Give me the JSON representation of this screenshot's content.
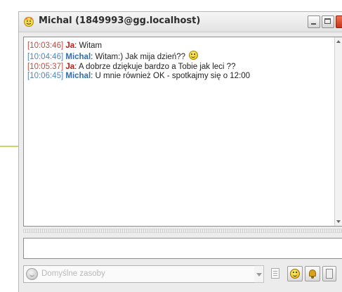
{
  "window": {
    "title": "Michal (1849993@gg.localhost)"
  },
  "chat": {
    "messages": [
      {
        "timestamp": "[10:03:46]",
        "nick": "Ja",
        "separator": ":",
        "text": " Witam",
        "emoticon": false
      },
      {
        "timestamp": "[10:04:46]",
        "nick": "Michal",
        "separator": ":",
        "text": " Witam:) Jak mija dzień??",
        "emoticon": true
      },
      {
        "timestamp": "[10:05:37]",
        "nick": "Ja",
        "separator": ":",
        "text": " A dobrze dziękuje bardzo a Tobie jak leci ??",
        "emoticon": false
      },
      {
        "timestamp": "[10:06:45]",
        "nick": "Michal",
        "separator": ":",
        "text": " U mnie również OK - spotkajmy się o 12:00",
        "emoticon": false
      }
    ]
  },
  "input": {
    "value": ""
  },
  "toolbar": {
    "emoticon_set_label": "Domyślne zasoby"
  },
  "colors": {
    "own_nick": "#b7211c",
    "peer_nick": "#2f6cb0",
    "own_timestamp": "#c24a3f",
    "peer_timestamp": "#4c86c0"
  },
  "icons": {
    "title": "emoticon-icon",
    "combo": "emoticon-icon",
    "history": "history-icon",
    "emoticons": "emoticon-icon",
    "alert": "bell-icon",
    "more": "window-icon"
  }
}
